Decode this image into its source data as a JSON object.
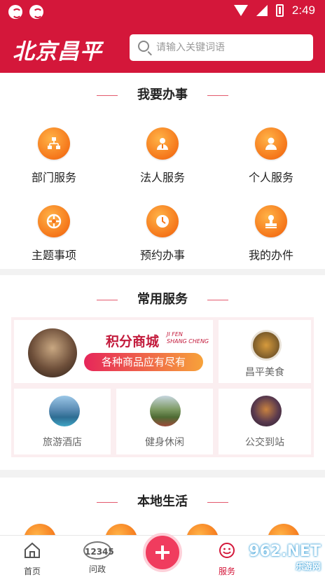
{
  "status_bar": {
    "time": "2:49"
  },
  "header": {
    "logo": "北京昌平",
    "search_placeholder": "请输入关键词语"
  },
  "sections": {
    "handle": {
      "title": "我要办事",
      "items": [
        {
          "label": "部门服务",
          "icon": "department-icon"
        },
        {
          "label": "法人服务",
          "icon": "legal-person-icon"
        },
        {
          "label": "个人服务",
          "icon": "personal-icon"
        },
        {
          "label": "主题事项",
          "icon": "theme-icon"
        },
        {
          "label": "预约办事",
          "icon": "clock-icon"
        },
        {
          "label": "我的办件",
          "icon": "stamp-icon"
        }
      ]
    },
    "common": {
      "title": "常用服务",
      "promo": {
        "title": "积分商城",
        "subtitle_1": "JI FEN",
        "subtitle_2": "SHANG CHENG",
        "slogan": "各种商品应有尽有"
      },
      "items": [
        {
          "label": "昌平美食"
        },
        {
          "label": "旅游酒店"
        },
        {
          "label": "健身休闲"
        },
        {
          "label": "公交到站"
        }
      ]
    },
    "local": {
      "title": "本地生活"
    }
  },
  "tabbar": {
    "tabs": [
      {
        "label": "首页"
      },
      {
        "label": "问政",
        "icon_text": "12345"
      },
      {
        "label": "服务"
      }
    ]
  },
  "watermark": {
    "line1": "962.NET",
    "line2": "乐游网"
  },
  "colors": {
    "brand": "#d4173a",
    "accent_orange": "#f5761a"
  }
}
